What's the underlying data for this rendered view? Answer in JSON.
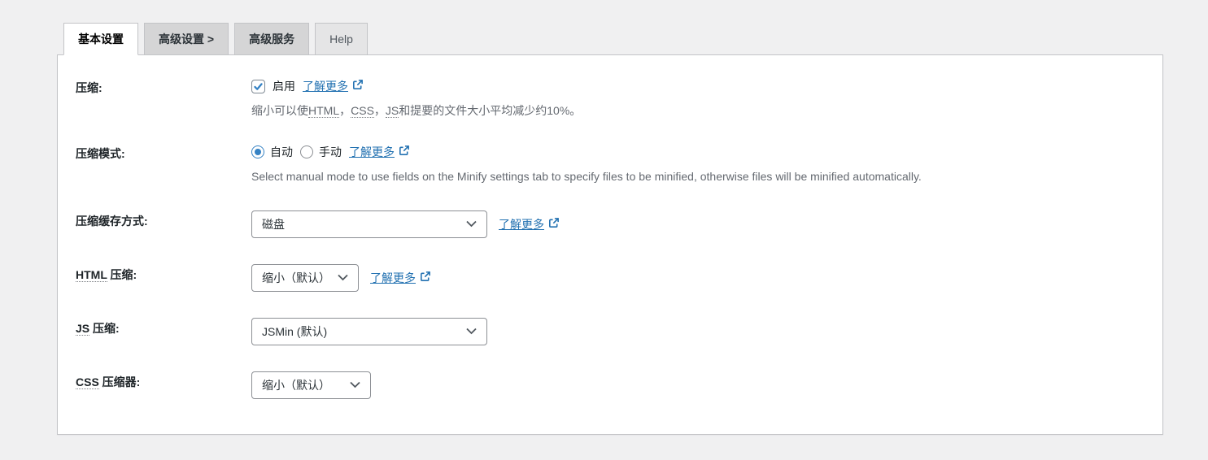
{
  "tabs": {
    "basic": "基本设置",
    "advanced": "高级设置 >",
    "services": "高级服务",
    "help": "Help"
  },
  "learn_more": "了解更多",
  "rows": {
    "minify": {
      "label": "压缩:",
      "checkbox_label": "启用",
      "checkbox_checked": true,
      "desc_parts": [
        "缩小可以使",
        "HTML",
        "，",
        "CSS",
        "，",
        "JS",
        "和提要的文件大小平均减少约10%。"
      ]
    },
    "minify_mode": {
      "label": "压缩模式:",
      "auto_label": "自动",
      "manual_label": "手动",
      "selected": "自动",
      "desc": "Select manual mode to use fields on the Minify settings tab to specify files to be minified, otherwise files will be minified automatically."
    },
    "cache_method": {
      "label": "压缩缓存方式:",
      "value": "磁盘"
    },
    "html_minifier": {
      "label_acronym": "HTML",
      "label_rest": " 压缩:",
      "value": "缩小（默认）"
    },
    "js_minifier": {
      "label_acronym": "JS",
      "label_rest": " 压缩:",
      "value": "JSMin (默认)"
    },
    "css_minifier": {
      "label_acronym": "CSS",
      "label_rest": " 压缩器:",
      "value": "缩小（默认）"
    }
  },
  "colors": {
    "accent_link": "#2271b1",
    "check_blue": "#3582c4",
    "page_bg": "#f0f0f1",
    "panel_border": "#c3c4c7",
    "desc_text": "#646970"
  }
}
